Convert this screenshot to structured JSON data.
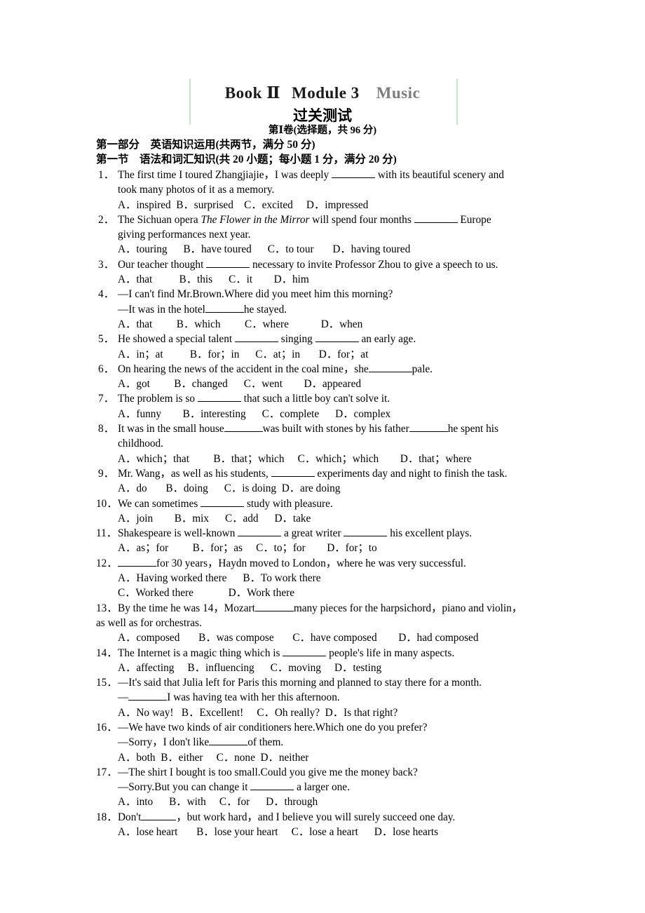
{
  "header": {
    "book": "Book Ⅱ",
    "module": "Module 3",
    "subject": "Music",
    "title_cn": "过关测试",
    "paper_line": "第Ⅰ卷(选择题，共 96 分)"
  },
  "sections": {
    "part_one": "第一部分　英语知识运用(共两节，满分 50 分)",
    "section_one": "第一节　语法和词汇知识(共 20 小题；每小题 1 分，满分 20 分)"
  },
  "questions": [
    {
      "num": "1．",
      "stem": "The first time I toured Zhangjiajie，I was deeply ",
      "stem_after": " with its beautiful scenery and",
      "cont": "took many photos of it as a memory.",
      "options": "A．inspired  B．surprised    C．excited     D．impressed"
    },
    {
      "num": "2．",
      "stem_pre": "The Sichuan opera ",
      "stem_italic": "The Flower in the Mirror",
      "stem_mid": " will spend four months ",
      "stem_after": " Europe",
      "cont": "giving performances next year.",
      "options": "A．touring      B．have toured      C．to tour       D．having toured"
    },
    {
      "num": "3．",
      "stem": "Our teacher thought ",
      "stem_after": " necessary to invite Professor Zhou to give a speech to us.",
      "options": "A．that          B．this      C．it        D．him"
    },
    {
      "num": "4．",
      "stem": "—I can't find Mr.Brown.Where did you meet him this morning?",
      "cont_pre": "—It was in the hotel",
      "cont_after": "he stayed.",
      "options": "A．that         B．which         C．where            D．when"
    },
    {
      "num": "5．",
      "stem": "He showed a special talent ",
      "stem_mid": " singing ",
      "stem_after": " an early age.",
      "options": "A．in；at          B．for；in      C．at；in       D．for；at"
    },
    {
      "num": "6．",
      "stem": "On hearing the news of the accident in the coal mine，she",
      "stem_after": "pale.",
      "options": "A．got         B．changed      C．went        D．appeared"
    },
    {
      "num": "7．",
      "stem": "The problem is so ",
      "stem_after": " that such a little boy can't solve it.",
      "options": "A．funny        B．interesting      C．complete      D．complex"
    },
    {
      "num": "8．",
      "stem": "It was in the small house",
      "stem_mid": "was built with stones by his father",
      "stem_after": "he spent his",
      "cont": "childhood.",
      "options": "A．which；that         B．that；which     C．which；which        D．that；where"
    },
    {
      "num": "9．",
      "stem": "Mr. Wang，as well as his students, ",
      "stem_after": " experiments day and night to finish the task.",
      "options": "A．do       B．doing      C．is doing  D．are doing"
    },
    {
      "num": "10．",
      "stem": "We can sometimes ",
      "stem_after": " study with pleasure.",
      "options": "A．join        B．mix      C．add      D．take"
    },
    {
      "num": "11．",
      "stem": "Shakespeare is well-known ",
      "stem_mid": " a great writer ",
      "stem_after": " his excellent plays.",
      "options": "A．as；for         B．for；as     C．to；for        D．for；to"
    },
    {
      "num": "12．",
      "stem_blank_first": true,
      "stem_after": "for 30 years，Haydn moved to London，where he was very successful.",
      "options": "A．Having worked there      B．To work there",
      "options2": "C．Worked there             D．Work there"
    },
    {
      "num": "13．",
      "stem": "By the time he was 14，Mozart",
      "stem_after": "many pieces for the harpsichord，piano and violin，",
      "cont": "as well as for orchestras.",
      "options": "A．composed       B．was compose       C．have composed        D．had composed"
    },
    {
      "num": "14．",
      "stem": "The Internet is a magic thing which is ",
      "stem_after": " people's life in many aspects.",
      "options": "A．affecting     B．influencing      C．moving     D．testing"
    },
    {
      "num": "15．",
      "stem": "—It's said that Julia left for Paris this morning and planned to stay there for a month.",
      "cont_pre": "—",
      "cont_after": "I was having tea with her this afternoon.",
      "options": "A．No way!   B．Excellent!     C．Oh really?  D．Is that right?"
    },
    {
      "num": "16．",
      "stem": "—We have two kinds of air conditioners here.Which one do you prefer?",
      "cont_pre": "—Sorry，I don't like",
      "cont_after": "of them.",
      "options": "A．both  B．either     C．none  D．neither"
    },
    {
      "num": "17．",
      "stem": "—The shirt I bought is too small.Could you give me the money back?",
      "cont_pre": "—Sorry.But you can change it ",
      "cont_after": " a larger one.",
      "options": "A．into      B．with     C．for      D．through"
    },
    {
      "num": "18．",
      "stem": "Don't",
      "stem_after": "，but work hard，and I believe you will surely succeed one day.",
      "options": "A．lose heart       B．lose your heart     C．lose a heart      D．lose hearts"
    }
  ],
  "colors": {
    "deco_rule": "#b9e3bd",
    "music_gray": "#7d7d7d",
    "text": "#000000"
  }
}
